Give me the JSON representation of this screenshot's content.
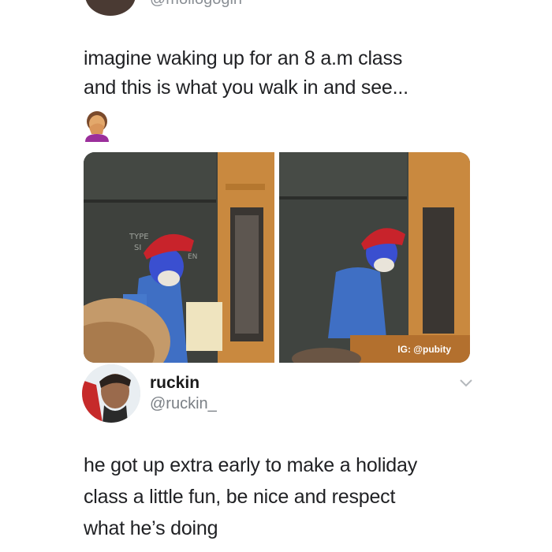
{
  "top_post": {
    "handle": "@mollogogin",
    "text_lines": [
      "imagine waking up for an 8 a.m class",
      "and this is what you walk in and see..."
    ],
    "emoji": "facepalm-emoji"
  },
  "photos": {
    "left_board_text": [
      "TYPE",
      "SI",
      "EN"
    ],
    "watermark": "IG: @pubity"
  },
  "reply": {
    "name": "ruckin",
    "handle": "@ruckin_",
    "text_lines": [
      "he got up extra early to make a holiday",
      "class a little fun, be nice and respect",
      "what he’s doing"
    ]
  },
  "colors": {
    "text": "#202124",
    "muted": "#7a7f85",
    "hat": "#c8232b",
    "face_paint": "#3a4fd0",
    "shirt": "#3f6fc4",
    "chalkboard": "#3d403c",
    "wood": "#c9893f"
  },
  "icons": [
    "chevron-down-icon"
  ]
}
